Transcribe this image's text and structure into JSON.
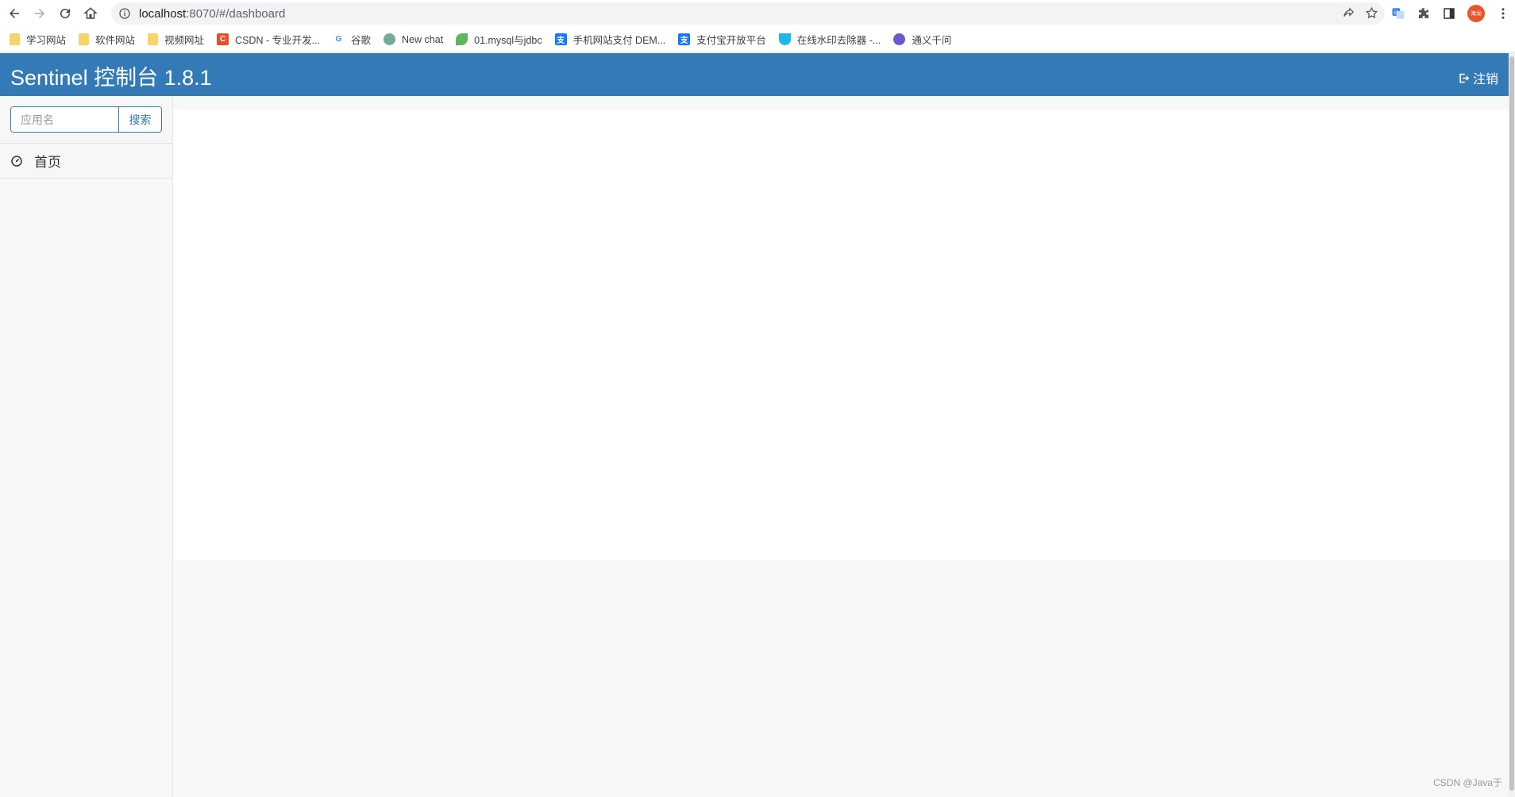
{
  "browser": {
    "url_host": "localhost",
    "url_path": ":8070/#/dashboard",
    "avatar_text": "海龙",
    "bookmarks": [
      {
        "label": "学习网站",
        "icon": "folder-icon"
      },
      {
        "label": "软件网站",
        "icon": "folder-icon"
      },
      {
        "label": "视频网址",
        "icon": "folder-icon"
      },
      {
        "label": "CSDN - 专业开发...",
        "icon": "csdn-icon"
      },
      {
        "label": "谷歌",
        "icon": "google-icon"
      },
      {
        "label": "New chat",
        "icon": "chatgpt-icon"
      },
      {
        "label": "01.mysql与jdbc",
        "icon": "leaf-icon"
      },
      {
        "label": "手机网站支付 DEM...",
        "icon": "alipay-icon"
      },
      {
        "label": "支付宝开放平台",
        "icon": "alipay-icon"
      },
      {
        "label": "在线水印去除器 -...",
        "icon": "watermark-icon"
      },
      {
        "label": "通义千问",
        "icon": "tongyi-icon"
      }
    ]
  },
  "header": {
    "title": "Sentinel 控制台 1.8.1",
    "logout_label": "注销",
    "color": "#337ab7"
  },
  "sidebar": {
    "search_placeholder": "应用名",
    "search_button": "搜索",
    "items": [
      {
        "label": "首页",
        "icon": "dashboard-icon"
      }
    ]
  },
  "watermark": "CSDN @Java于"
}
